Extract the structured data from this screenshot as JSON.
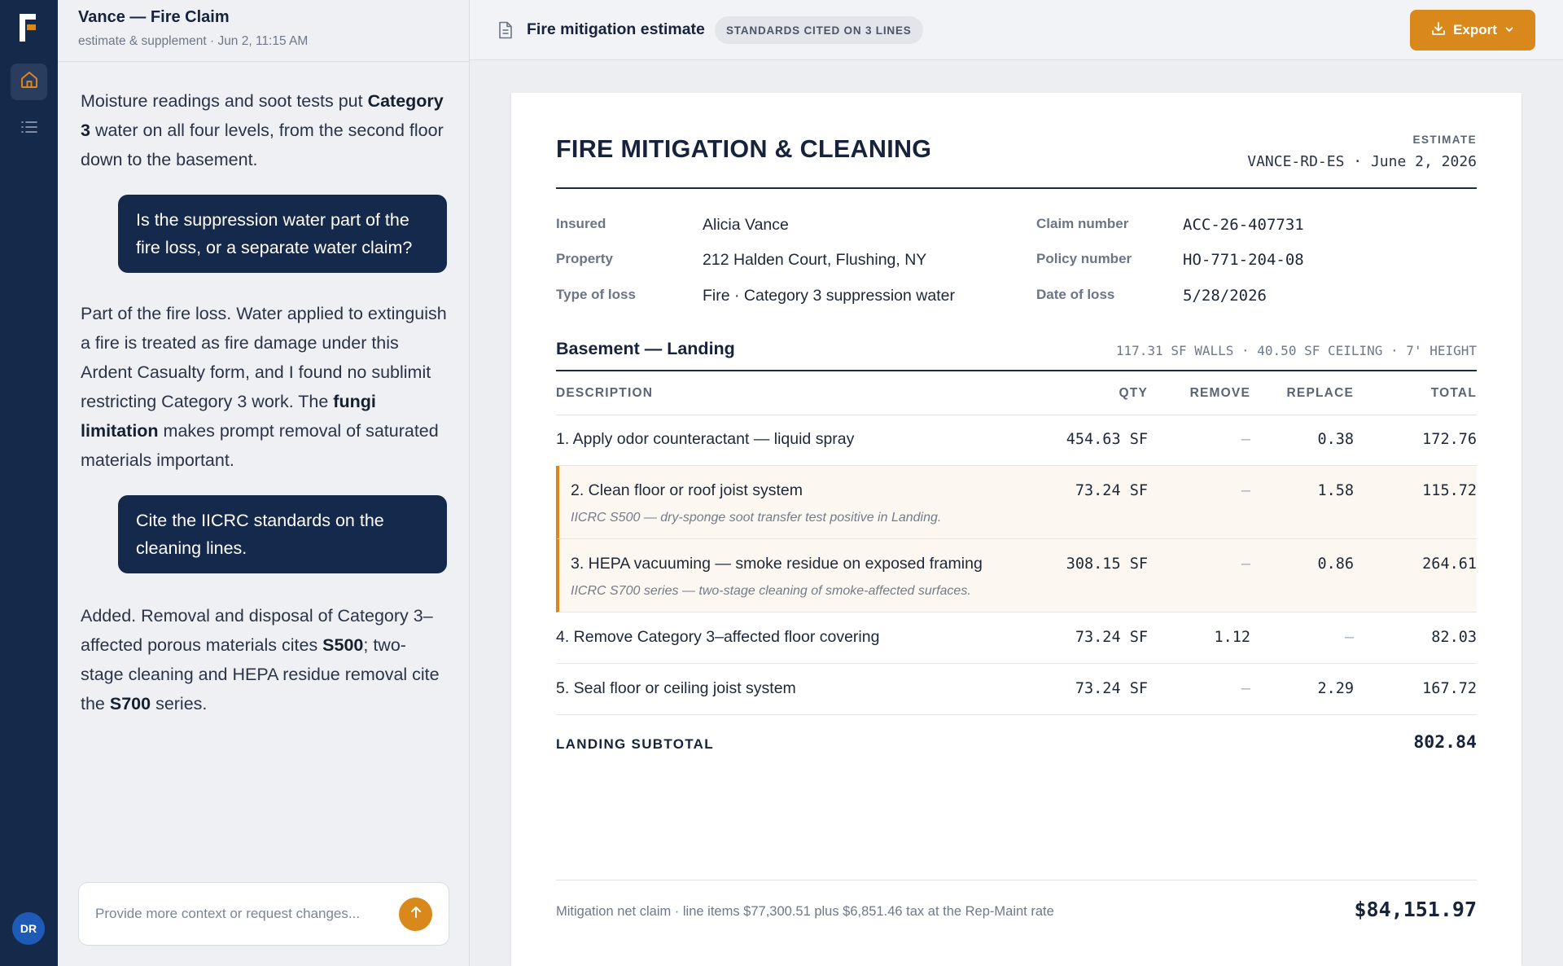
{
  "sidebar": {
    "avatar_initials": "DR",
    "nav_items": [
      {
        "icon": "home-icon",
        "active": true
      },
      {
        "icon": "list-icon",
        "active": false
      }
    ]
  },
  "chat": {
    "title": "Vance — Fire Claim",
    "subtitle": "estimate & supplement · Jun 2, 11:15 AM",
    "composer_placeholder": "Provide more context or request changes...",
    "messages": [
      {
        "role": "assistant",
        "parts": [
          "Moisture readings and soot tests put ",
          "Category 3",
          " water on all four levels, from the second floor down to the basement."
        ]
      },
      {
        "role": "user",
        "text": "Is the suppression water part of the fire loss, or a separate water claim?"
      },
      {
        "role": "assistant",
        "parts": [
          "Part of the fire loss. Water applied to extinguish a fire is treated as fire damage under this Ardent Casualty form, and I found no sublimit restricting Category 3 work. The ",
          "fungi limitation",
          " makes prompt removal of saturated materials important."
        ]
      },
      {
        "role": "user",
        "text": "Cite the IICRC standards on the cleaning lines."
      },
      {
        "role": "assistant",
        "parts": [
          "Added. Removal and disposal of Category 3–affected porous materials cites ",
          "S500",
          "; two-stage cleaning and HEPA residue removal cite the ",
          "S700",
          " series."
        ]
      }
    ]
  },
  "topbar": {
    "doc_title": "Fire mitigation estimate",
    "badge": "STANDARDS CITED ON 3 LINES",
    "export_label": "Export",
    "accent_color": "#d9891c"
  },
  "document": {
    "heading": "FIRE MITIGATION & CLEANING",
    "doc_type": "ESTIMATE",
    "reference": "VANCE-RD-ES · June 2, 2026",
    "meta": {
      "insured_label": "Insured",
      "insured": "Alicia Vance",
      "property_label": "Property",
      "property": "212 Halden Court, Flushing, NY",
      "loss_type_label": "Type of loss",
      "loss_type": "Fire · Category 3 suppression water",
      "claim_label": "Claim number",
      "claim": "ACC-26-407731",
      "policy_label": "Policy number",
      "policy": "HO-771-204-08",
      "date_label": "Date of loss",
      "date": "5/28/2026"
    },
    "section": {
      "title": "Basement — Landing",
      "dimensions": "117.31 SF WALLS · 40.50 SF CEILING · 7' HEIGHT"
    },
    "columns": {
      "description": "DESCRIPTION",
      "qty": "QTY",
      "remove": "REMOVE",
      "replace": "REPLACE",
      "total": "TOTAL"
    },
    "lines": [
      {
        "description": "1. Apply odor counteractant — liquid spray",
        "qty": "454.63 SF",
        "remove": "–",
        "replace": "0.38",
        "total": "172.76",
        "note": ""
      },
      {
        "description": "2. Clean floor or roof joist system",
        "qty": "73.24 SF",
        "remove": "–",
        "replace": "1.58",
        "total": "115.72",
        "note": "IICRC S500 — dry-sponge soot transfer test positive in Landing."
      },
      {
        "description": "3. HEPA vacuuming — smoke residue on exposed framing",
        "qty": "308.15 SF",
        "remove": "–",
        "replace": "0.86",
        "total": "264.61",
        "note": "IICRC S700 series — two-stage cleaning of smoke-affected surfaces."
      },
      {
        "description": "4. Remove Category 3–affected floor covering",
        "qty": "73.24 SF",
        "remove": "1.12",
        "replace": "–",
        "total": "82.03",
        "note": ""
      },
      {
        "description": "5. Seal floor or ceiling joist system",
        "qty": "73.24 SF",
        "remove": "–",
        "replace": "2.29",
        "total": "167.72",
        "note": ""
      }
    ],
    "subtotal_label": "LANDING SUBTOTAL",
    "subtotal_value": "802.84",
    "footer_note": "Mitigation net claim · line items $77,300.51 plus $6,851.46 tax at the Rep-Maint rate",
    "footer_total": "$84,151.97"
  }
}
